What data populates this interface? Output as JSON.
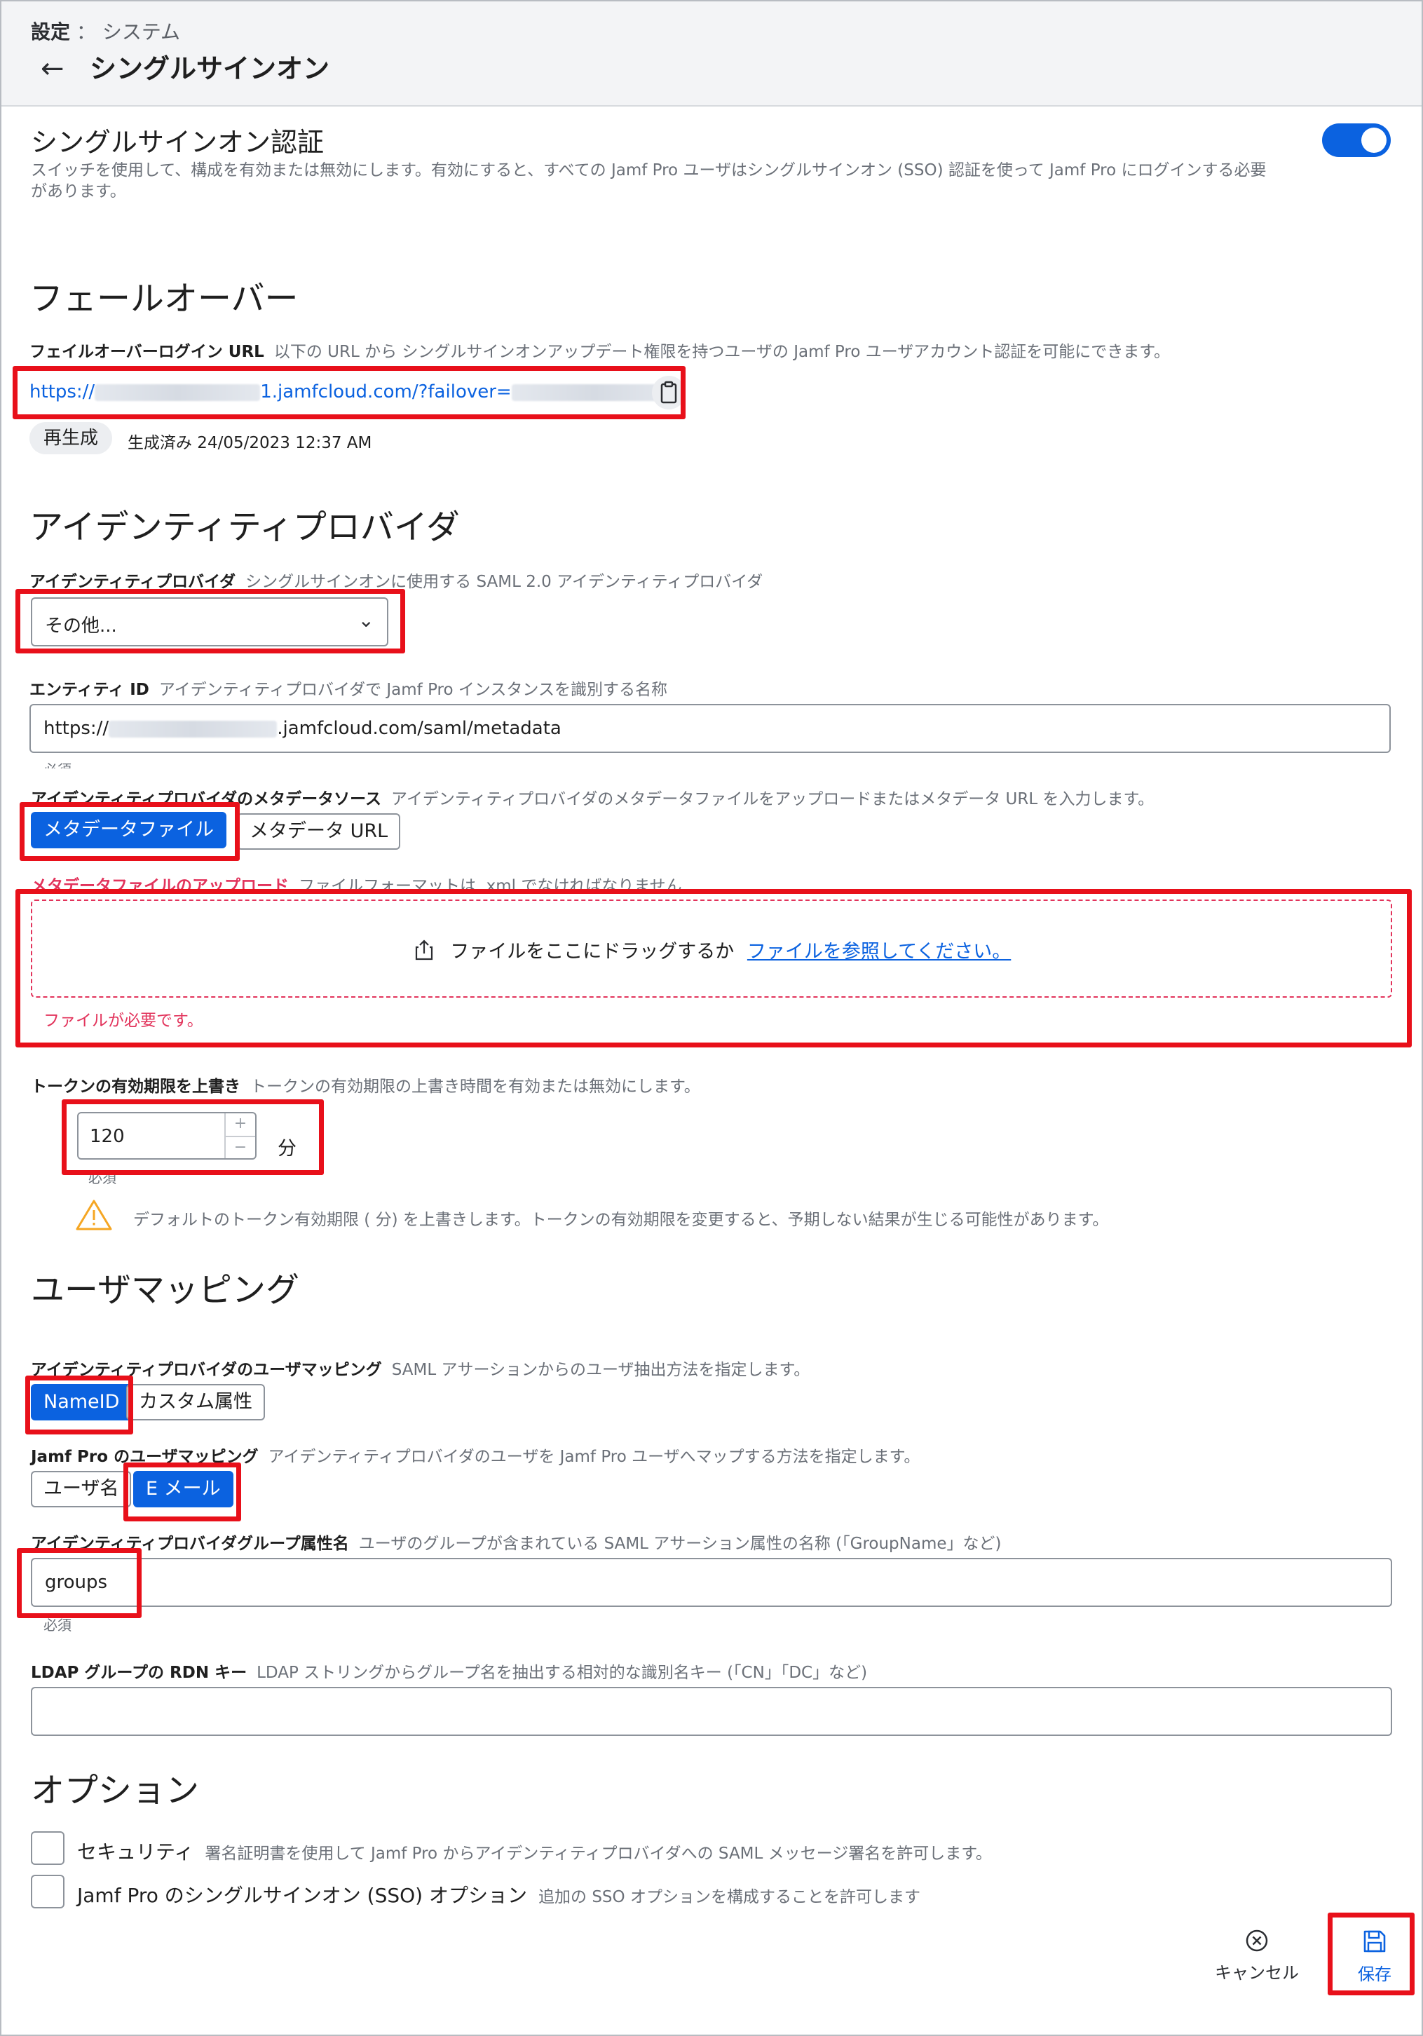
{
  "header": {
    "breadcrumb_section": "設定",
    "breadcrumb_sep": "：",
    "breadcrumb_page": "システム",
    "title": "シングルサインオン"
  },
  "sso": {
    "title": "シングルサインオン認証",
    "desc_line1": "スイッチを使用して、構成を有効または無効にします。有効にすると、すべての Jamf Pro ユーザはシングルサインオン (SSO) 認証を使って Jamf Pro にログインする必要",
    "desc_line2": "があります。",
    "enabled": true
  },
  "failover": {
    "heading": "フェールオーバー",
    "label": "フェイルオーバーログイン URL",
    "desc": "以下の URL から シングルサインオンアップデート権限を持つユーザの Jamf Pro ユーザアカウント認証を可能にできます。",
    "url_prefix": "https://",
    "url_middle": "1.jamfcloud.com/?failover=",
    "regenerate": "再生成",
    "generated": "生成済み 24/05/2023 12:37 AM"
  },
  "idp": {
    "heading": "アイデンティティプロバイダ",
    "label": "アイデンティティプロバイダ",
    "desc": "シングルサインオンに使用する SAML 2.0 アイデンティティプロバイダ",
    "selected": "その他..."
  },
  "entity": {
    "label": "エンティティ ID",
    "desc": "アイデンティティプロバイダで Jamf Pro インスタンスを識別する名称",
    "value_prefix": "https://",
    "value_suffix": ".jamfcloud.com/saml/metadata",
    "hint": "必須"
  },
  "metadata_source": {
    "label": "アイデンティティプロバイダのメタデータソース",
    "desc": "アイデンティティプロバイダのメタデータファイルをアップロードまたはメタデータ URL を入力します。",
    "options": [
      "メタデータファイル",
      "メタデータ URL"
    ],
    "selected": "メタデータファイル"
  },
  "upload": {
    "label": "メタデータファイルのアップロード",
    "desc": "ファイルフォーマットは .xml でなければなりません",
    "drop_text": "ファイルをここにドラッグするか",
    "browse_link": "ファイルを参照してください。",
    "error": "ファイルが必要です。",
    "label_color": "#e2335b"
  },
  "token": {
    "label": "トークンの有効期限を上書き",
    "desc": "トークンの有効期限の上書き時間を有効または無効にします。",
    "value": "120",
    "unit": "分",
    "required": "必須",
    "warning": "デフォルトのトークン有効期限 ( 分) を上書きします。トークンの有効期限を変更すると、予期しない結果が生じる可能性があります。"
  },
  "user_mapping": {
    "heading": "ユーザマッピング",
    "idp_label": "アイデンティティプロバイダのユーザマッピング",
    "idp_desc": "SAML アサーションからのユーザ抽出方法を指定します。",
    "idp_options": [
      "NameID",
      "カスタム属性"
    ],
    "idp_selected": "NameID",
    "jamf_label": "Jamf Pro のユーザマッピング",
    "jamf_desc": "アイデンティティプロバイダのユーザを Jamf Pro ユーザへマップする方法を指定します。",
    "jamf_options": [
      "ユーザ名",
      "E メール"
    ],
    "jamf_selected": "E メール",
    "group_label": "アイデンティティプロバイダグループ属性名",
    "group_desc": "ユーザのグループが含まれている SAML アサーション属性の名称 (「GroupName」など)",
    "group_value": "groups",
    "group_required": "必須",
    "ldap_label": "LDAP グループの RDN キー",
    "ldap_desc": "LDAP ストリングからグループ名を抽出する相対的な識別名キー (「CN」「DC」など)",
    "ldap_value": ""
  },
  "options": {
    "heading": "オプション",
    "security_label": "セキュリティ",
    "security_desc": "署名証明書を使用して Jamf Pro からアイデンティティプロバイダへの SAML メッセージ署名を許可します。",
    "security_checked": false,
    "sso_label": "Jamf Pro のシングルサインオン (SSO) オプション",
    "sso_desc": "追加の SSO オプションを構成することを許可します",
    "sso_checked": false
  },
  "footer": {
    "cancel": "キャンセル",
    "save": "保存"
  },
  "colors": {
    "accent": "#0b62e0",
    "error": "#e2335b",
    "highlight": "#e8101a",
    "warning": "#f5a623"
  }
}
